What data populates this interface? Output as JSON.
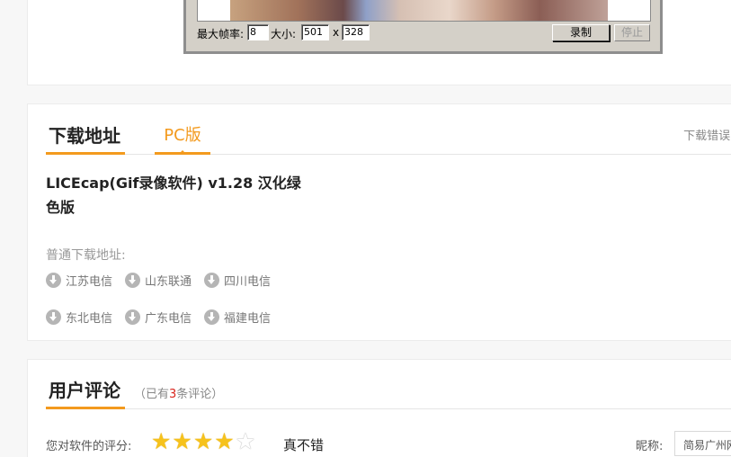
{
  "licecap": {
    "max_fps_label": "最大帧率:",
    "max_fps_value": "8",
    "size_label": "大小:",
    "width_value": "501",
    "size_separator": "x",
    "height_value": "328",
    "record_label": "录制",
    "stop_label": "停止"
  },
  "download": {
    "tab_title": "下载地址",
    "tab_pc": "PC版",
    "report_error": "下载错误?",
    "file_title": "LICEcap(Gif录像软件) v1.28 汉化绿色版",
    "normal_heading": "普通下载地址:",
    "mirrors": [
      "江苏电信",
      "山东联通",
      "四川电信",
      "东北电信",
      "广东电信",
      "福建电信"
    ]
  },
  "comments": {
    "tab_title": "用户评论",
    "count_prefix": "（已有",
    "count_value": "3",
    "count_suffix": "条评论）",
    "rating_label": "您对软件的评分:",
    "rating_value": 4,
    "rating_max": 5,
    "rating_text": "真不错",
    "nickname_label": "昵称:",
    "nickname_value": "简易广州网友"
  },
  "colors": {
    "accent": "#f39a1e",
    "count_highlight": "#d9241c",
    "star": "#f6c21c"
  }
}
